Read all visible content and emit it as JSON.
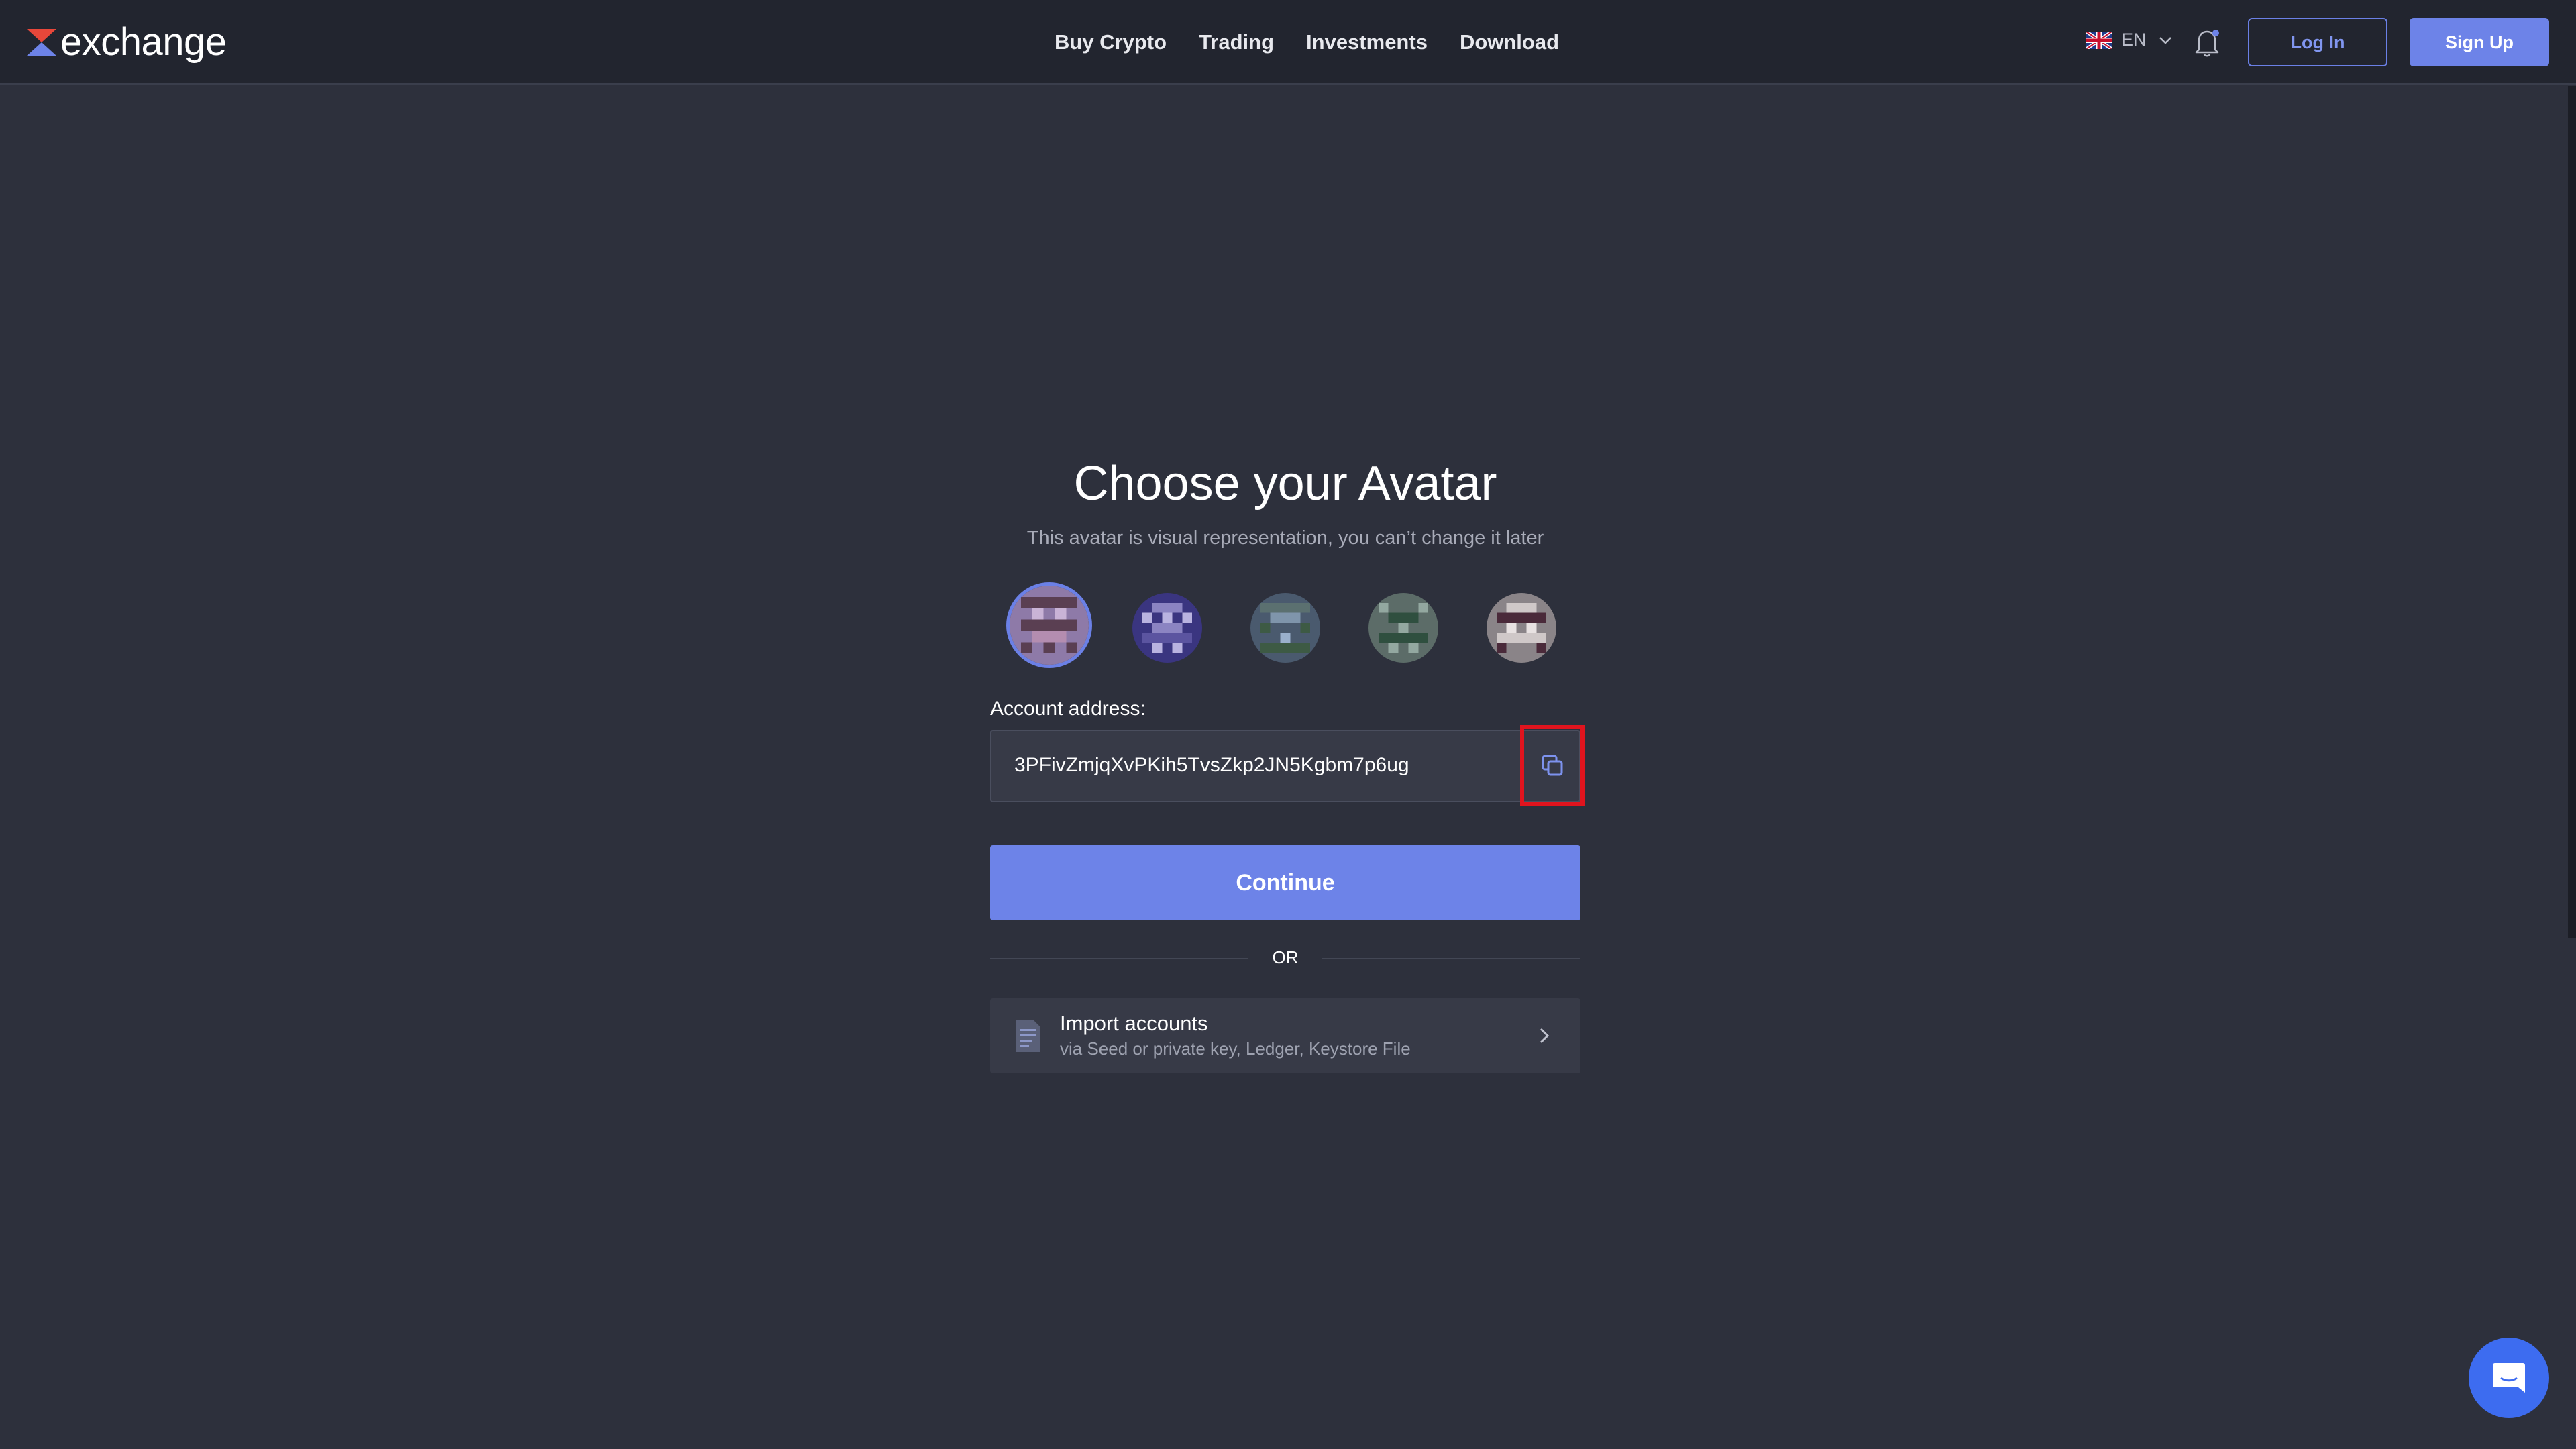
{
  "header": {
    "logo_text": "exchange",
    "nav": [
      "Buy Crypto",
      "Trading",
      "Investments",
      "Download"
    ],
    "language": "EN",
    "login_label": "Log In",
    "signup_label": "Sign Up"
  },
  "main": {
    "title": "Choose your Avatar",
    "subtitle": "This avatar is visual representation, you can’t change it later",
    "avatars_count": 5,
    "selected_avatar": 1,
    "account_address_label": "Account address:",
    "account_address": "3PFivZmjqXvPKih5TvsZkp2JN5Kgbm7p6ug",
    "continue_label": "Continue",
    "or_label": "OR",
    "import": {
      "title": "Import accounts",
      "subtitle": "via Seed or private key, Ledger, Keystore File"
    }
  },
  "colors": {
    "accent": "#6d83e8",
    "background": "#2d303c",
    "header": "#22252f",
    "highlight": "#e0141e"
  }
}
